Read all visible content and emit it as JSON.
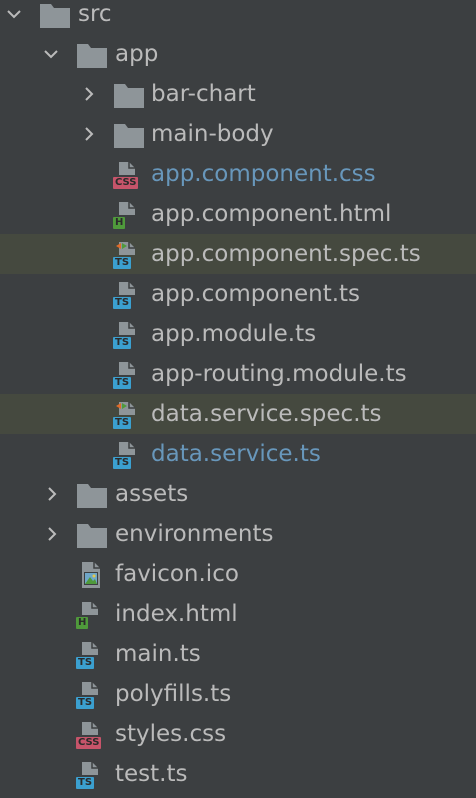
{
  "tree": {
    "items": [
      {
        "label": "src",
        "type": "folder",
        "expanded": true
      },
      {
        "label": "app",
        "type": "folder",
        "expanded": true
      },
      {
        "label": "bar-chart",
        "type": "folder",
        "expanded": false
      },
      {
        "label": "main-body",
        "type": "folder",
        "expanded": false
      },
      {
        "label": "app.component.css",
        "type": "css",
        "badge": "CSS",
        "modified": true
      },
      {
        "label": "app.component.html",
        "type": "html",
        "badge": "H"
      },
      {
        "label": "app.component.spec.ts",
        "type": "spec",
        "badge": "TS",
        "highlighted": true
      },
      {
        "label": "app.component.ts",
        "type": "ts",
        "badge": "TS"
      },
      {
        "label": "app.module.ts",
        "type": "ts",
        "badge": "TS"
      },
      {
        "label": "app-routing.module.ts",
        "type": "ts",
        "badge": "TS"
      },
      {
        "label": "data.service.spec.ts",
        "type": "spec",
        "badge": "TS",
        "highlighted": true
      },
      {
        "label": "data.service.ts",
        "type": "ts",
        "badge": "TS",
        "modified": true
      },
      {
        "label": "assets",
        "type": "folder",
        "expanded": false
      },
      {
        "label": "environments",
        "type": "folder",
        "expanded": false
      },
      {
        "label": "favicon.ico",
        "type": "image"
      },
      {
        "label": "index.html",
        "type": "html",
        "badge": "H"
      },
      {
        "label": "main.ts",
        "type": "ts",
        "badge": "TS"
      },
      {
        "label": "polyfills.ts",
        "type": "ts",
        "badge": "TS"
      },
      {
        "label": "styles.css",
        "type": "css",
        "badge": "CSS"
      },
      {
        "label": "test.ts",
        "type": "ts",
        "badge": "TS"
      }
    ]
  },
  "colors": {
    "background": "#3c3f41",
    "text": "#bbbbbb",
    "modified_text": "#6897bb",
    "highlight_row": "#45493f",
    "folder": "#8e9599",
    "ts_badge": "#3ba0d0",
    "css_badge": "#c7546a",
    "html_badge": "#4f9a3b"
  }
}
